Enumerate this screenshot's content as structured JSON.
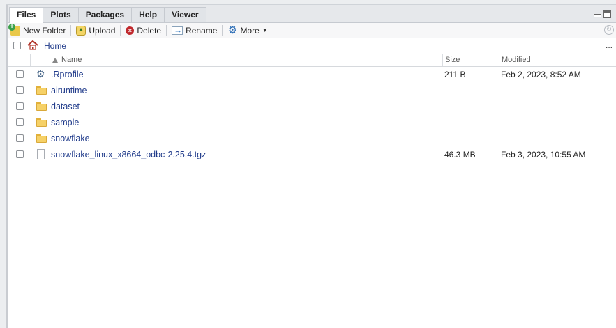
{
  "tabs": [
    "Files",
    "Plots",
    "Packages",
    "Help",
    "Viewer"
  ],
  "active_tab": "Files",
  "toolbar": {
    "new_folder": "New Folder",
    "upload": "Upload",
    "delete": "Delete",
    "rename": "Rename",
    "more": "More"
  },
  "path": {
    "home": "Home",
    "more": "..."
  },
  "columns": {
    "name": "Name",
    "size": "Size",
    "modified": "Modified"
  },
  "files": [
    {
      "name": ".Rprofile",
      "type": "rprofile",
      "size": "211 B",
      "modified": "Feb 2, 2023, 8:52 AM"
    },
    {
      "name": "airuntime",
      "type": "folder",
      "size": "",
      "modified": ""
    },
    {
      "name": "dataset",
      "type": "folder",
      "size": "",
      "modified": ""
    },
    {
      "name": "sample",
      "type": "folder",
      "size": "",
      "modified": ""
    },
    {
      "name": "snowflake",
      "type": "folder",
      "size": "",
      "modified": ""
    },
    {
      "name": "snowflake_linux_x8664_odbc-2.25.4.tgz",
      "type": "file",
      "size": "46.3 MB",
      "modified": "Feb 3, 2023, 10:55 AM"
    }
  ],
  "icons": {
    "new_folder": "new-folder-icon",
    "upload": "upload-icon",
    "delete": "delete-icon",
    "rename": "rename-icon",
    "more": "gear-icon",
    "home": "home-icon",
    "refresh": "refresh-icon"
  }
}
